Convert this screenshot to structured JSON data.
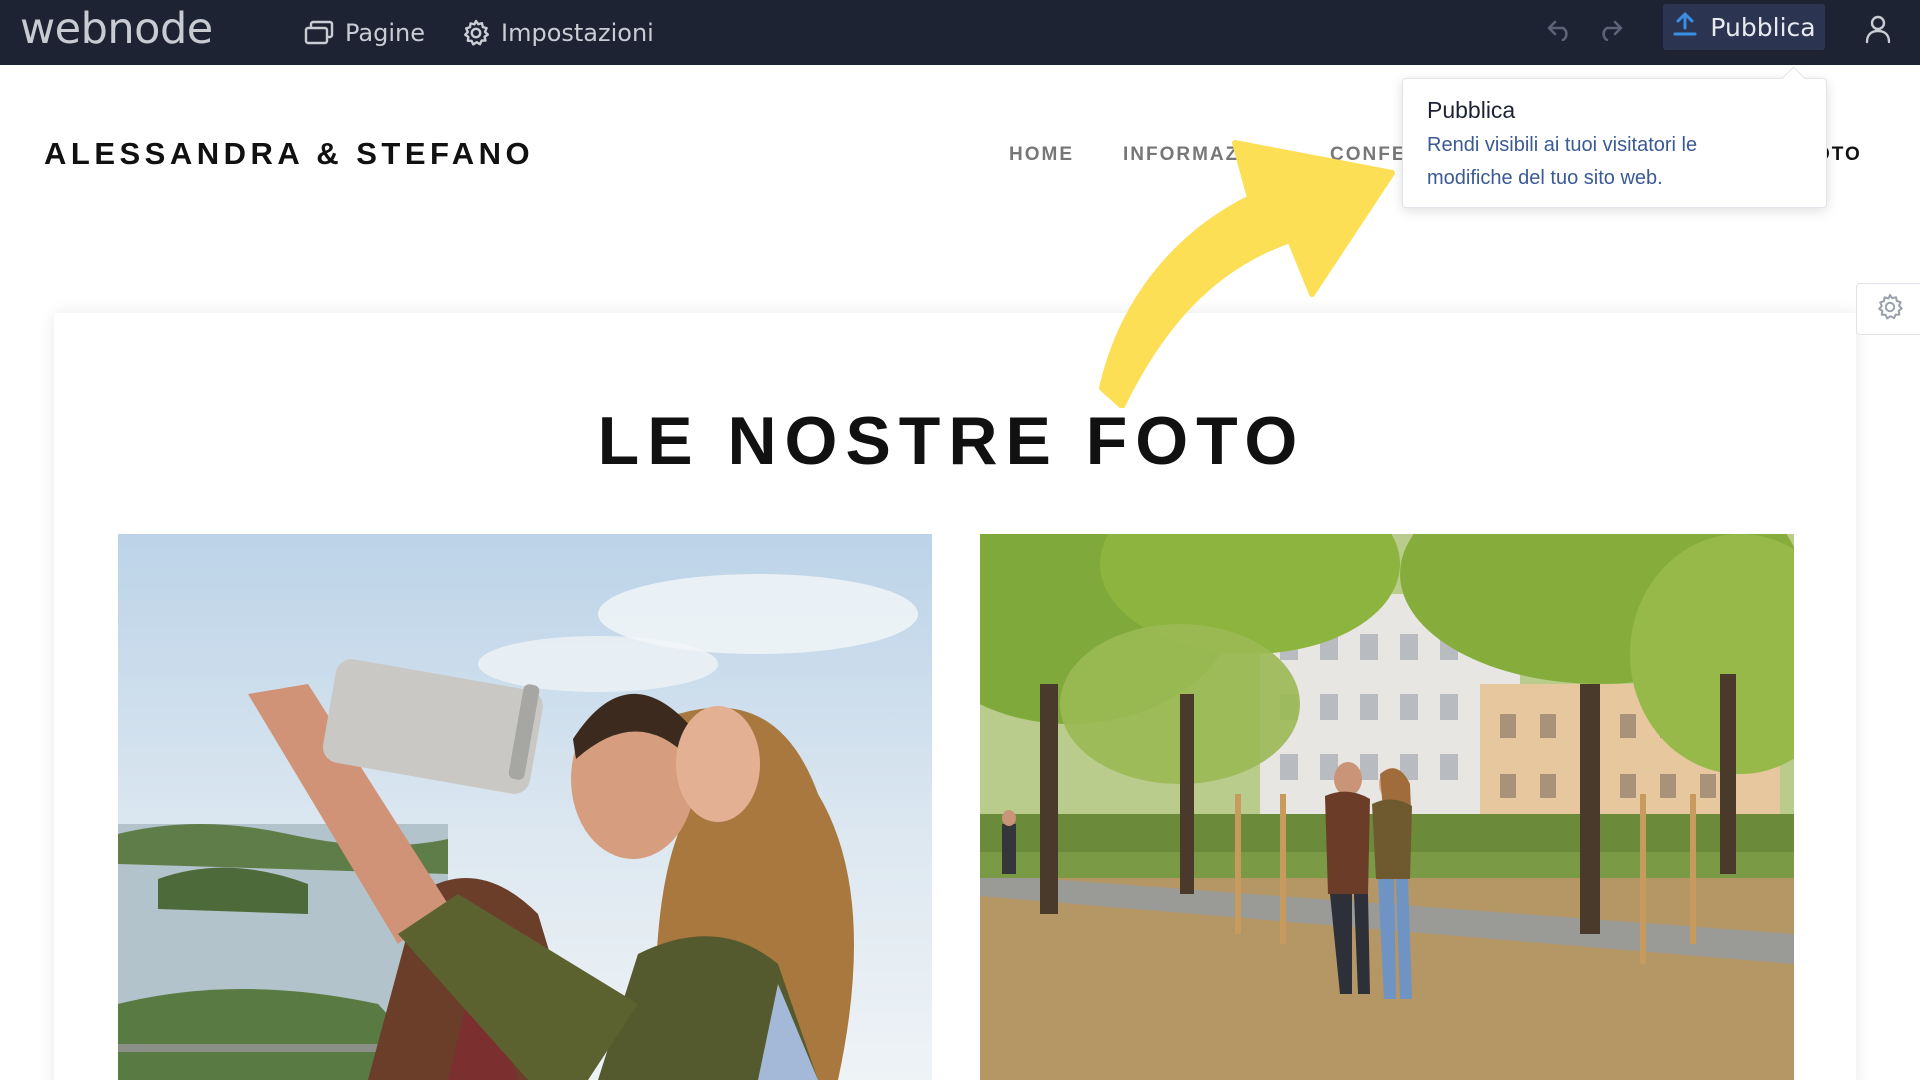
{
  "editor": {
    "logo": "webnode",
    "nav": {
      "pages_label": "Pagine",
      "settings_label": "Impostazioni"
    },
    "publish_label": "Pubblica"
  },
  "site": {
    "title": "ALESSANDRA & STEFANO",
    "menu": {
      "home": "HOME",
      "info": "INFORMAZI",
      "conf": "CONFE",
      "foto": "OTO"
    }
  },
  "tooltip": {
    "title": "Pubblica",
    "text": "Rendi visibili ai tuoi visitatori le modifiche del tuo sito web."
  },
  "section": {
    "heading": "LE NOSTRE FOTO"
  },
  "colors": {
    "topbar_bg": "#1d2333",
    "publish_bg": "#2b3552",
    "publish_icon": "#3a8ee6",
    "tooltip_text": "#3a5a96",
    "arrow": "#fddf55"
  },
  "icons": {
    "pages": "pages-icon",
    "settings": "gear-icon",
    "undo": "undo-icon",
    "redo": "redo-icon",
    "publish": "upload-icon",
    "user": "user-icon",
    "section_settings": "gear-icon"
  }
}
